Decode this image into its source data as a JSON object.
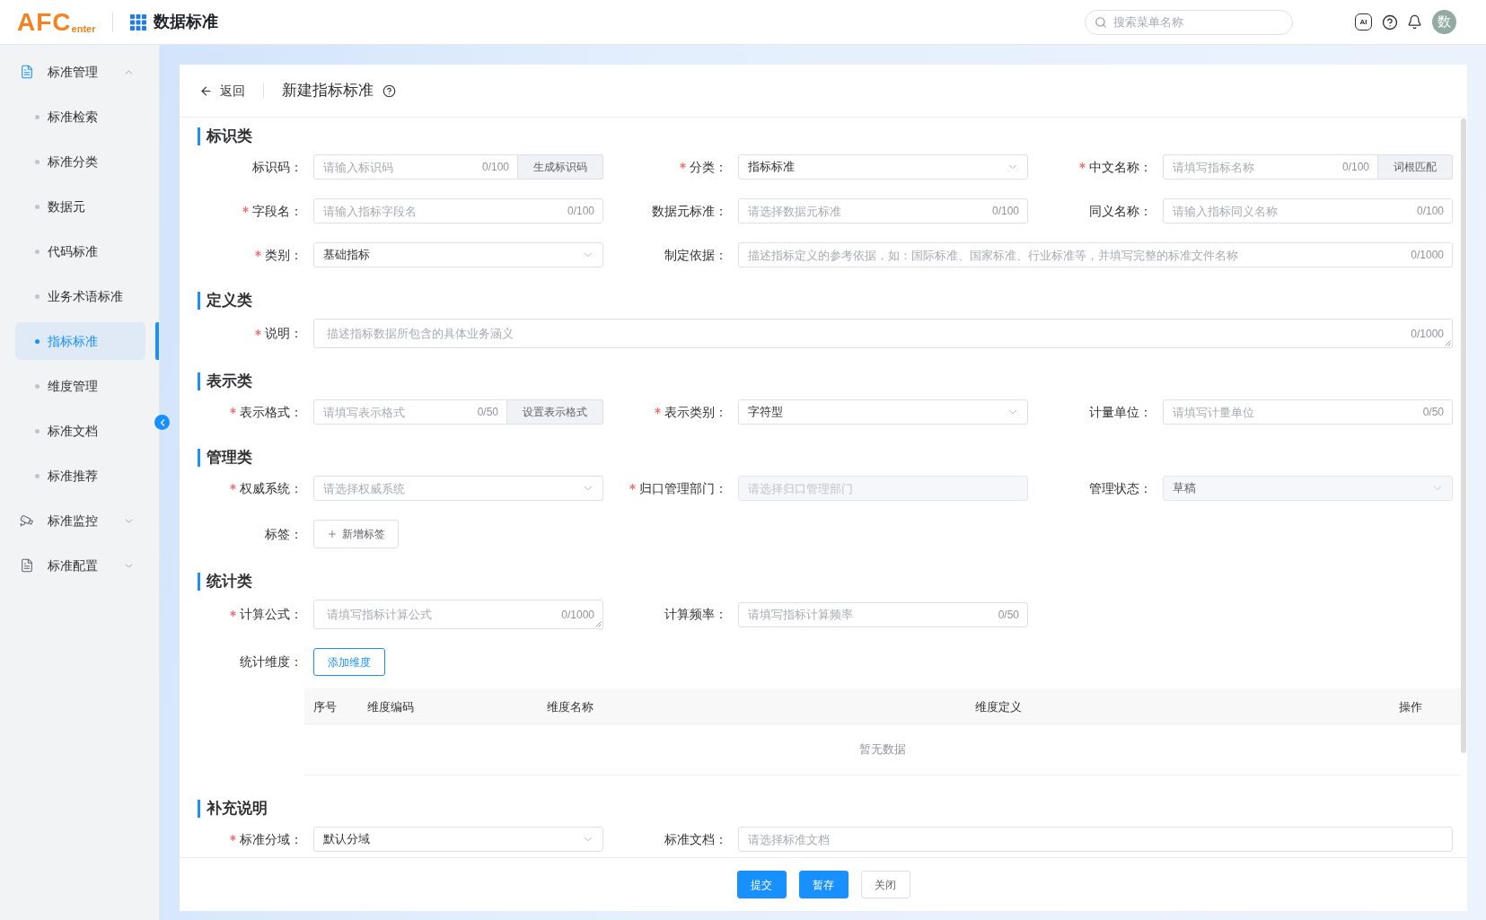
{
  "header": {
    "logo": {
      "main": "AFC",
      "sub": "enter"
    },
    "title": "数据标准",
    "search": {
      "placeholder": "搜索菜单名称"
    },
    "ai_label": "AI",
    "avatar": "数"
  },
  "sidebar": {
    "items": [
      {
        "label": "标准管理",
        "expanded": true,
        "children": [
          {
            "label": "标准检索",
            "selected": false
          },
          {
            "label": "标准分类",
            "selected": false
          },
          {
            "label": "数据元",
            "selected": false
          },
          {
            "label": "代码标准",
            "selected": false
          },
          {
            "label": "业务术语标准",
            "selected": false
          },
          {
            "label": "指标标准",
            "selected": true
          },
          {
            "label": "维度管理",
            "selected": false
          },
          {
            "label": "标准文档",
            "selected": false
          },
          {
            "label": "标准推荐",
            "selected": false
          }
        ]
      },
      {
        "label": "标准监控",
        "expanded": false
      },
      {
        "label": "标准配置",
        "expanded": false
      }
    ]
  },
  "page": {
    "back": "返回",
    "title": "新建指标标准"
  },
  "sections": [
    {
      "title": "标识类",
      "rows": [
        {
          "fields": [
            {
              "label": "标识码：",
              "required": false,
              "disabled": false,
              "kind": "input",
              "placeholder": "请输入标识码",
              "counter": "0/100",
              "append": "生成标识码"
            },
            {
              "label": "分类：",
              "required": true,
              "disabled": false,
              "kind": "select",
              "value": "指标标准"
            },
            {
              "label": "中文名称：",
              "required": true,
              "disabled": false,
              "kind": "input",
              "placeholder": "请填写指标名称",
              "counter": "0/100",
              "append": "词根匹配"
            }
          ]
        },
        {
          "fields": [
            {
              "label": "字段名：",
              "required": true,
              "disabled": false,
              "kind": "input",
              "placeholder": "请输入指标字段名",
              "counter": "0/100"
            },
            {
              "label": "数据元标准：",
              "required": false,
              "disabled": false,
              "kind": "input",
              "placeholder": "请选择数据元标准",
              "counter": "0/100"
            },
            {
              "label": "同义名称：",
              "required": false,
              "disabled": false,
              "kind": "input",
              "placeholder": "请输入指标同义名称",
              "counter": "0/100"
            }
          ]
        },
        {
          "fields": [
            {
              "label": "类别：",
              "required": true,
              "disabled": false,
              "kind": "select",
              "value": "基础指标"
            },
            {
              "label": "制定依据：",
              "required": false,
              "disabled": false,
              "kind": "input_wide",
              "placeholder": "描述指标定义的参考依据，如：国际标准、国家标准、行业标准等，并填写完整的标准文件名称",
              "counter": "0/1000"
            }
          ]
        }
      ]
    },
    {
      "title": "定义类",
      "rows": [
        {
          "fields": [
            {
              "label": "说明：",
              "required": true,
              "disabled": false,
              "kind": "textarea_wide",
              "placeholder": "描述指标数据所包含的具体业务涵义",
              "counter": "0/1000"
            }
          ]
        }
      ]
    },
    {
      "title": "表示类",
      "rows": [
        {
          "fields": [
            {
              "label": "表示格式：",
              "required": true,
              "disabled": false,
              "kind": "input",
              "placeholder": "请填写表示格式",
              "counter": "0/50",
              "append": "设置表示格式"
            },
            {
              "label": "表示类别：",
              "required": true,
              "disabled": false,
              "kind": "select",
              "value": "字符型"
            },
            {
              "label": "计量单位：",
              "required": false,
              "disabled": false,
              "kind": "input",
              "placeholder": "请填写计量单位",
              "counter": "0/50"
            }
          ]
        }
      ]
    },
    {
      "title": "管理类",
      "rows": [
        {
          "fields": [
            {
              "label": "权威系统：",
              "required": true,
              "disabled": false,
              "kind": "select",
              "placeholder": "请选择权威系统"
            },
            {
              "label": "归口管理部门：",
              "required": true,
              "disabled": true,
              "kind": "input",
              "placeholder": "请选择归口管理部门"
            },
            {
              "label": "管理状态：",
              "required": false,
              "disabled": true,
              "kind": "select",
              "value": "草稿"
            }
          ]
        },
        {
          "fields": [
            {
              "label": "标签：",
              "required": false,
              "disabled": false,
              "kind": "tag_add",
              "button": "新增标签"
            }
          ]
        }
      ]
    },
    {
      "title": "统计类",
      "rows": [
        {
          "fields": [
            {
              "label": "计算公式：",
              "required": true,
              "disabled": false,
              "kind": "textarea",
              "placeholder": "请填写指标计算公式",
              "counter": "0/1000"
            },
            {
              "label": "计算频率：",
              "required": false,
              "disabled": false,
              "kind": "input",
              "placeholder": "请填写指标计算频率",
              "counter": "0/50"
            }
          ]
        },
        {
          "fields": [
            {
              "label": "统计维度：",
              "required": false,
              "disabled": false,
              "kind": "button",
              "button": "添加维度"
            }
          ]
        }
      ],
      "table": {
        "columns": [
          "序号",
          "维度编码",
          "维度名称",
          "维度定义",
          "操作"
        ],
        "empty_text": "暂无数据"
      }
    },
    {
      "title": "补充说明",
      "rows": [
        {
          "fields": [
            {
              "label": "标准分域：",
              "required": true,
              "disabled": false,
              "kind": "select",
              "value": "默认分域"
            },
            {
              "label": "标准文档：",
              "required": false,
              "disabled": false,
              "kind": "input_wide",
              "placeholder": "请选择标准文档"
            }
          ]
        }
      ]
    }
  ],
  "footer": {
    "buttons": [
      {
        "label": "提交",
        "kind": "primary"
      },
      {
        "label": "暂存",
        "kind": "primary"
      },
      {
        "label": "关闭",
        "kind": "default"
      }
    ]
  }
}
